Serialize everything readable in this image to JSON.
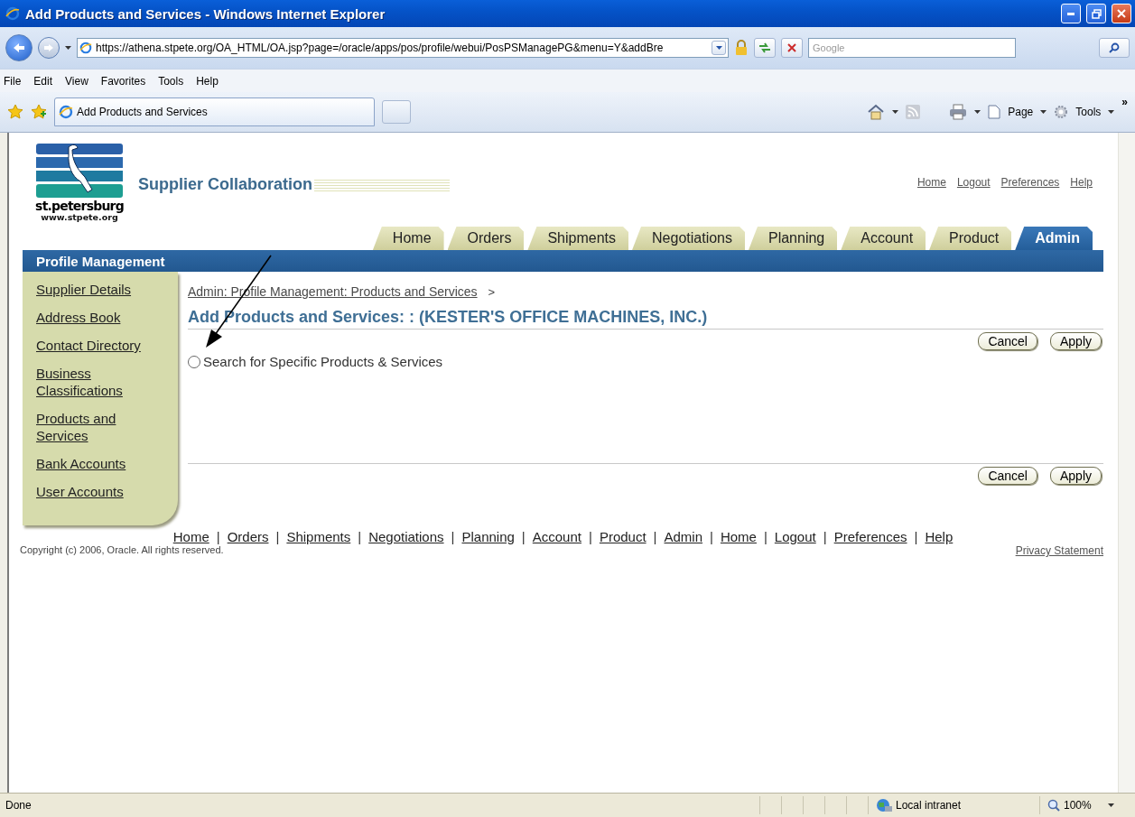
{
  "window": {
    "title": "Add Products and Services - Windows Internet Explorer"
  },
  "address_bar": {
    "url": "https://athena.stpete.org/OA_HTML/OA.jsp?page=/oracle/apps/pos/profile/webui/PosPSManagePG&menu=Y&addBre"
  },
  "search": {
    "placeholder": "Google"
  },
  "menu_bar": [
    "File",
    "Edit",
    "View",
    "Favorites",
    "Tools",
    "Help"
  ],
  "browser_tab": {
    "label": "Add Products and Services"
  },
  "command_bar": {
    "page": "Page",
    "tools": "Tools",
    "more": "»"
  },
  "logo": {
    "name": "st.petersburg",
    "site": "www.stpete.org"
  },
  "app_title": "Supplier Collaboration",
  "global_links": [
    "Home",
    "Logout",
    "Preferences",
    "Help"
  ],
  "tabs": [
    {
      "label": "Home",
      "selected": false
    },
    {
      "label": "Orders",
      "selected": false
    },
    {
      "label": "Shipments",
      "selected": false
    },
    {
      "label": "Negotiations",
      "selected": false
    },
    {
      "label": "Planning",
      "selected": false
    },
    {
      "label": "Account",
      "selected": false
    },
    {
      "label": "Product",
      "selected": false
    },
    {
      "label": "Admin",
      "selected": true
    }
  ],
  "section_header": "Profile Management",
  "sidebar": {
    "items": [
      {
        "label": "Supplier Details"
      },
      {
        "label": "Address Book"
      },
      {
        "label": "Contact Directory"
      },
      {
        "label": "Business Classifications"
      },
      {
        "label": "Products and Services"
      },
      {
        "label": "Bank Accounts"
      },
      {
        "label": "User Accounts"
      }
    ]
  },
  "breadcrumb": {
    "link": "Admin: Profile Management: Products and Services",
    "separator": ">"
  },
  "page_title": "Add Products and Services: : (KESTER'S OFFICE MACHINES, INC.)",
  "top_buttons": [
    "Cancel",
    "Apply"
  ],
  "bottom_buttons": [
    "Cancel",
    "Apply"
  ],
  "options": [
    {
      "label": "Search for Specific Products & Services",
      "selected": false
    }
  ],
  "footer_links": [
    "Home",
    "Orders",
    "Shipments",
    "Negotiations",
    "Planning",
    "Account",
    "Product",
    "Admin",
    "Home",
    "Logout",
    "Preferences",
    "Help"
  ],
  "footer_separator": "|",
  "copyright": "Copyright (c) 2006, Oracle. All rights reserved.",
  "privacy": "Privacy Statement",
  "status_bar": {
    "text": "Done",
    "zone": "Local intranet",
    "zoom": "100%"
  }
}
